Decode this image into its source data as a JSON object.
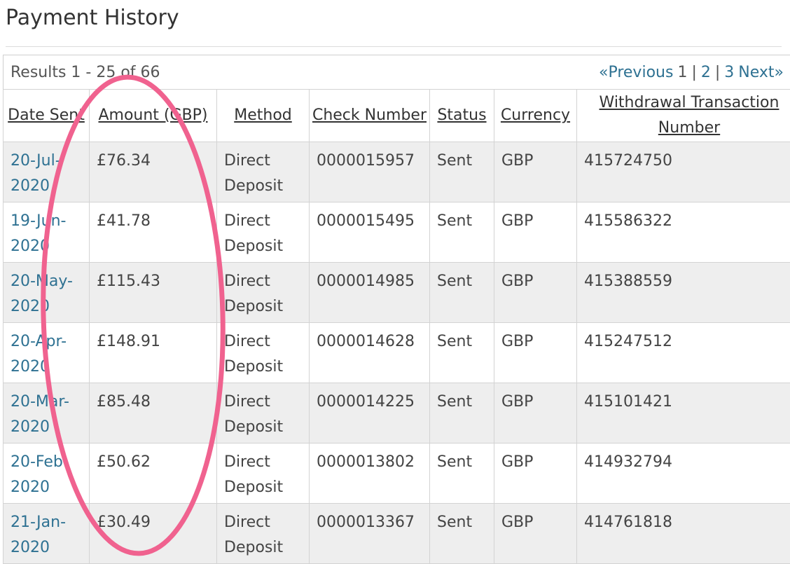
{
  "page_title": "Payment History",
  "results_summary": "Results 1 - 25 of 66",
  "pagination": {
    "previous": "«Previous",
    "current": "1",
    "separator": "|",
    "pages": [
      "2",
      "3"
    ],
    "next": "Next»"
  },
  "table": {
    "columns": {
      "date": "Date Sent",
      "amount": "Amount (GBP)",
      "method": "Method",
      "check": "Check Number",
      "status": "Status",
      "currency": "Currency",
      "withdrawal": "Withdrawal Transaction Number"
    },
    "rows": [
      {
        "date": "20-Jul-2020",
        "amount": "£76.34",
        "method": "Direct Deposit",
        "check": "0000015957",
        "status": "Sent",
        "currency": "GBP",
        "withdrawal": "415724750"
      },
      {
        "date": "19-Jun-2020",
        "amount": "£41.78",
        "method": "Direct Deposit",
        "check": "0000015495",
        "status": "Sent",
        "currency": "GBP",
        "withdrawal": "415586322"
      },
      {
        "date": "20-May-2020",
        "amount": "£115.43",
        "method": "Direct Deposit",
        "check": "0000014985",
        "status": "Sent",
        "currency": "GBP",
        "withdrawal": "415388559"
      },
      {
        "date": "20-Apr-2020",
        "amount": "£148.91",
        "method": "Direct Deposit",
        "check": "0000014628",
        "status": "Sent",
        "currency": "GBP",
        "withdrawal": "415247512"
      },
      {
        "date": "20-Mar-2020",
        "amount": "£85.48",
        "method": "Direct Deposit",
        "check": "0000014225",
        "status": "Sent",
        "currency": "GBP",
        "withdrawal": "415101421"
      },
      {
        "date": "20-Feb-2020",
        "amount": "£50.62",
        "method": "Direct Deposit",
        "check": "0000013802",
        "status": "Sent",
        "currency": "GBP",
        "withdrawal": "414932794"
      },
      {
        "date": "21-Jan-2020",
        "amount": "£30.49",
        "method": "Direct Deposit",
        "check": "0000013367",
        "status": "Sent",
        "currency": "GBP",
        "withdrawal": "414761818"
      }
    ]
  },
  "colors": {
    "link": "#2e7192",
    "annotation": "#f0628f",
    "row_stripe": "#eeeeee"
  }
}
